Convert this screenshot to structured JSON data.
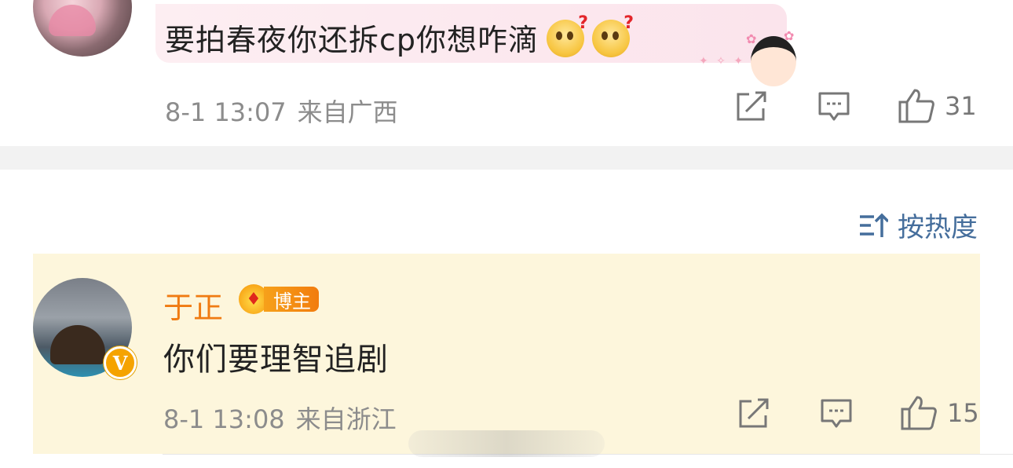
{
  "comment1": {
    "text": "要拍春夜你还拆cp你想咋滴",
    "emojis": [
      "question-face-emoji",
      "question-face-emoji"
    ],
    "time": "8-1 13:07",
    "location": "来自广西",
    "likes": "31"
  },
  "sort": {
    "label": "按热度"
  },
  "comment2": {
    "username": "于正",
    "badge_label": "博主",
    "text": "你们要理智追剧",
    "time": "8-1 13:08",
    "location": "来自浙江",
    "likes": "15"
  },
  "colors": {
    "username": "#f07b12",
    "highlight_bg": "#fdf6dc",
    "bubble_bg": "#fbe4ec",
    "sort_blue": "#456e9c",
    "meta_gray": "#8c8c8c"
  }
}
